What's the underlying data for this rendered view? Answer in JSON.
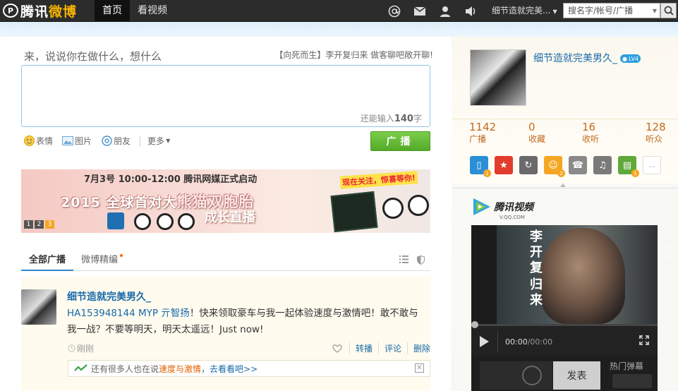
{
  "app": {
    "logo_text_1": "腾讯",
    "logo_text_2": "微博"
  },
  "nav": {
    "tabs": [
      "首页",
      "看视频"
    ]
  },
  "header": {
    "icons": [
      "at-icon",
      "mail-icon",
      "user-icon",
      "volume-icon"
    ],
    "user_menu_label": "细节造就完美...",
    "search_placeholder": "搜名字/帐号/广播"
  },
  "compose": {
    "prompt": "来，说说你在做什么，想什么",
    "topic_text": "【向死而生】李开复归来 做客聊吧敞开聊!",
    "char_count_prefix": "还能输入",
    "char_count_value": "140",
    "char_count_suffix": "字",
    "tools": [
      "表情",
      "图片",
      "朋友",
      "更多"
    ],
    "post_label": "广播"
  },
  "banner": {
    "top_text": "7月3号 10:00-12:00 腾讯网媒正式启动",
    "main_prefix": "2015 全球首对大",
    "main_big": "熊猫双胞胎",
    "sub_text": "成长直播",
    "follow_text": "现在关注，惊喜等你!",
    "pages": [
      "1",
      "2",
      "3"
    ],
    "active_page": 3
  },
  "feed": {
    "tabs": [
      "全部广播",
      "微博精编"
    ],
    "post": {
      "author": "细节造就完美男久_",
      "mention": "HA153948144 MYP 亓智扬",
      "text": "！快来领取豪车与我一起体验速度与激情吧！敢不敢与我一战？不要等明天，明天太遥远！Just now!",
      "time": "刚刚",
      "actions": [
        "转播",
        "评论",
        "删除"
      ],
      "hint_prefix": "还有很多人也在说",
      "hint_highlight": "速度与激情",
      "hint_more": "，去看看吧>>"
    }
  },
  "profile": {
    "name": "细节造就完美男久_",
    "level": "LV4",
    "stats": [
      {
        "num": "1142",
        "label": "广播"
      },
      {
        "num": "0",
        "label": "收藏"
      },
      {
        "num": "16",
        "label": "收听"
      },
      {
        "num": "128",
        "label": "听众"
      }
    ],
    "apps": [
      {
        "icon": "phone-app-icon",
        "color": "#2b8fd6",
        "badge": "1"
      },
      {
        "icon": "star-app-icon",
        "color": "#e23c2c",
        "badge": ""
      },
      {
        "icon": "refresh-app-icon",
        "color": "#6a6a6a",
        "badge": ""
      },
      {
        "icon": "game-app-icon",
        "color": "#f5a623",
        "badge": "2"
      },
      {
        "icon": "telephone-app-icon",
        "color": "#8a8a8a",
        "badge": ""
      },
      {
        "icon": "music-app-icon",
        "color": "#7a7a7a",
        "badge": ""
      },
      {
        "icon": "card-app-icon",
        "color": "#5fa83a",
        "badge": "1"
      }
    ],
    "more_label": "..."
  },
  "video": {
    "brand": "腾讯视频",
    "url": "V.QQ.COM",
    "title_col1": [
      "李",
      "开",
      "复"
    ],
    "title_col2": [
      "归",
      "来"
    ],
    "time_current": "00:00",
    "time_total": "/00:00",
    "send_label": "发表",
    "hot_label": "热门弹幕"
  }
}
